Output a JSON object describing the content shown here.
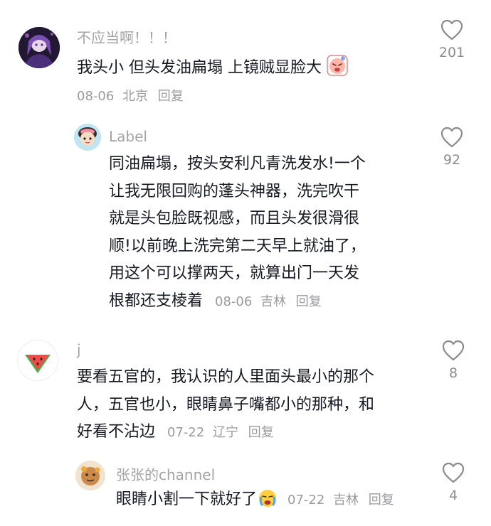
{
  "comments": [
    {
      "username": "不应当啊！！！",
      "text": "我头小 但头发油扁塌 上镜贼显脸大",
      "date": "08-06",
      "location": "北京",
      "reply_label": "回复",
      "likes": "201",
      "emoji_icon": "pouting-face-emoji",
      "avatar_icon": "anime-girl-avatar"
    },
    {
      "username": "Label",
      "lines": [
        "同油扁塌，按头安利凡青洗发水!一个",
        "让我无限回购的蓬头神器，洗完吹干",
        "就是头包脸既视感，而且头发很滑很",
        "顺!以前晚上洗完第二天早上就油了，",
        "用这个可以撑两天，就算出门一天发",
        "根都还支棱着"
      ],
      "date": "08-06",
      "location": "吉林",
      "reply_label": "回复",
      "likes": "92",
      "avatar_icon": "cartoon-character-avatar"
    },
    {
      "username": "j",
      "lines": [
        "要看五官的，我认识的人里面头最小的那个",
        "人，五官也小，眼睛鼻子嘴都小的那种，和",
        "好看不沾边"
      ],
      "date": "07-22",
      "location": "辽宁",
      "reply_label": "回复",
      "likes": "8",
      "avatar_icon": "watermelon-avatar"
    },
    {
      "username": "张张的channel",
      "text": "眼睛小割一下就好了",
      "date": "07-22",
      "location": "吉林",
      "reply_label": "回复",
      "likes": "4",
      "emoji_icon": "crying-face-emoji",
      "avatar_icon": "cookie-character-avatar"
    }
  ],
  "colors": {
    "text": "#161823",
    "username": "#a3a3a8",
    "meta": "#9a9aa0",
    "heart": "#8a8a90"
  }
}
